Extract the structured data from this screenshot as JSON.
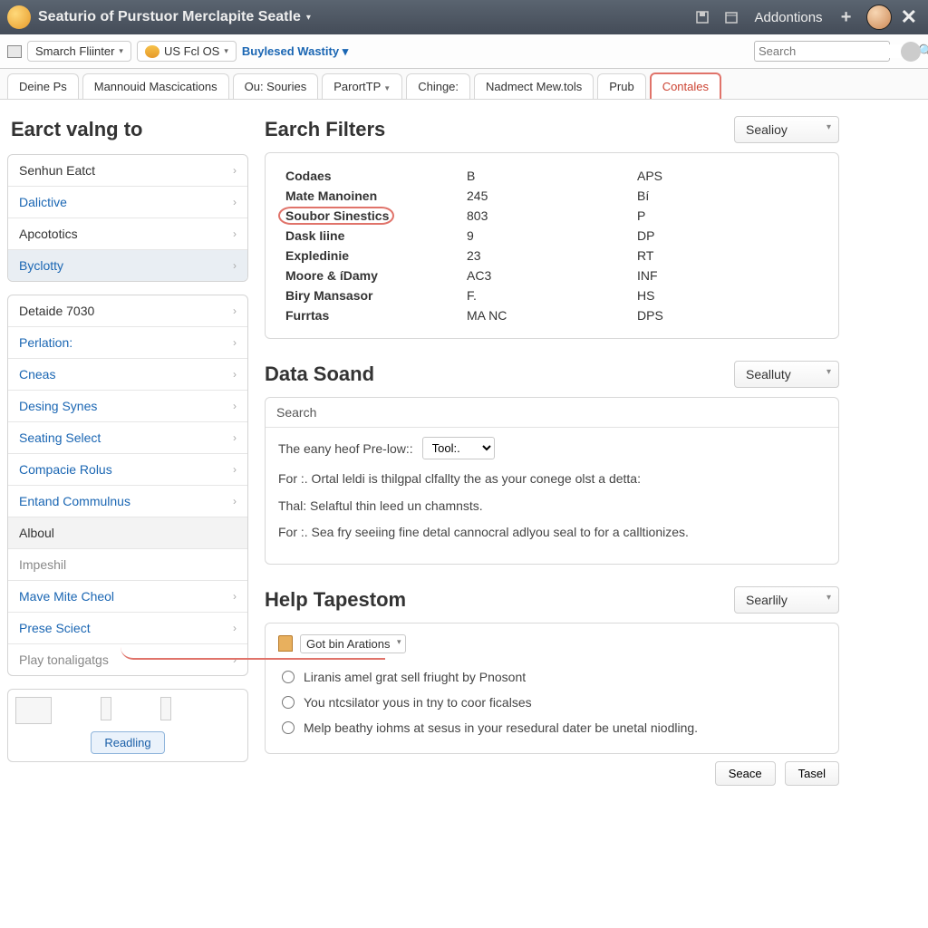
{
  "titlebar": {
    "title": "Seaturio of Purstuor Merclapite Seatle",
    "addons": "Addontions"
  },
  "toolbar": {
    "smarch": "Smarch Fliinter",
    "usfcl": "US Fcl OS",
    "buylesed": "Buylesed Wastity",
    "search_placeholder": "Search"
  },
  "tabs": [
    "Deine Ps",
    "Mannouid Mascications",
    "Ou: Souries",
    "ParortTP",
    "Chinge:",
    "Nadmect Mew.tols",
    "Prub",
    "Contales"
  ],
  "sidebar": {
    "heading": "Earct valng to",
    "group1": [
      "Senhun Eatct",
      "Dalictive",
      "Apcototics",
      "Byclotty"
    ],
    "group2": [
      "Detaide 7030",
      "Perlation:",
      "Cneas",
      "Desing Synes",
      "Seating Select",
      "Compacie Rolus",
      "Entand Commulnus",
      "Alboul",
      "Impeshil",
      "Mave Mite Cheol",
      "Prese Sciect",
      "Play tonaligatgs"
    ],
    "reading": "Readling"
  },
  "filters": {
    "title": "Earch Filters",
    "action": "Sealioy",
    "rows": [
      {
        "a": "Codaes",
        "b": "B",
        "c": "APS"
      },
      {
        "a": "Mate Manoinen",
        "b": "245",
        "c": "Bí"
      },
      {
        "a": "Soubor Sinestics",
        "b": "803",
        "c": "P"
      },
      {
        "a": "Dask Iiine",
        "b": "9",
        "c": "DP"
      },
      {
        "a": "Expledinie",
        "b": "23",
        "c": "RT"
      },
      {
        "a": "Moore & íDamy",
        "b": "AC3",
        "c": "INF"
      },
      {
        "a": "Biry Mansasor",
        "b": "F.",
        "c": "HS"
      },
      {
        "a": "Furrtas",
        "b": "MA NC",
        "c": "DPS"
      }
    ]
  },
  "datasound": {
    "title": "Data Soand",
    "action": "Sealluty",
    "search_label": "Search",
    "pre_label": "The eany heof Pre-low::",
    "tool_option": "Tool:.",
    "p1": "For :.  Ortal leldi is thilgpal clfallty the as your conege olst a detta:",
    "p2": "Thal:  Selaftul thin leed un chamnsts.",
    "p3": "For :.  Sea fry seeiing fine detal cannocral adlyou seal to for a calltionizes."
  },
  "help": {
    "title": "Help Tapestom",
    "action": "Searlily",
    "got": "Got bin Arations",
    "opts": [
      "Liranis amel grat sell friught by Pnosont",
      "You ntcsilator yous in tny to coor ficalses",
      "Melp beathy iohms at sesus in your resedural dater be unetal niodling."
    ],
    "btn1": "Seace",
    "btn2": "Tasel"
  }
}
